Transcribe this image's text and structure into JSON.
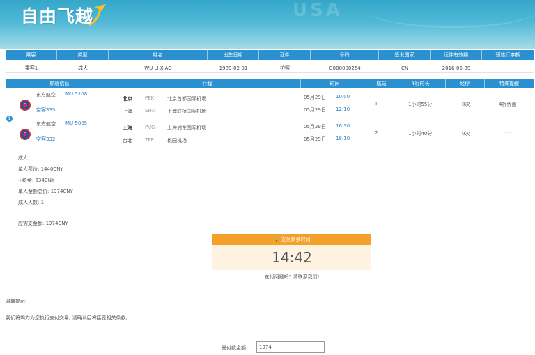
{
  "header": {
    "logo_text": "自由飞越",
    "background_text": "USA"
  },
  "passenger_table": {
    "headers": [
      "乘客",
      "类型",
      "姓名",
      "出生日期",
      "证件",
      "号码",
      "签发国家",
      "证件有效期",
      "预达行李额"
    ],
    "row": [
      "乘客1",
      "成人",
      "WU LI XIAO",
      "1989-02-01",
      "护照",
      "G000000254",
      "CN",
      "2016-05-09",
      "· · ·"
    ]
  },
  "flight_table": {
    "headers": [
      "航班信息",
      "行程",
      "时间",
      "航站",
      "飞行时长",
      "经停",
      "特殊提醒"
    ],
    "segments": [
      {
        "airline": "东方航空",
        "flight_no": "MU 5108",
        "aircraft": "空客333",
        "stops": [
          {
            "city": "北京",
            "code": "PEK",
            "airport": "北京首都国际机场",
            "date": "05月29日",
            "time": "10:00"
          },
          {
            "city": "上海",
            "code": "SHA",
            "airport": "上海虹桥国际机场",
            "date": "05月29日",
            "time": "12:10"
          }
        ],
        "terminal": "T",
        "duration": "1小时55分",
        "stop_count": "0次",
        "note": "4折优惠"
      },
      {
        "airline": "东方航空",
        "flight_no": "MU 5005",
        "aircraft": "空客332",
        "stops": [
          {
            "city": "上海",
            "code": "PVG",
            "airport": "上海浦东国际机场",
            "date": "05月29日",
            "time": "16:30"
          },
          {
            "city": "台北",
            "code": "TPE",
            "airport": "桃园机场",
            "date": "05月29日",
            "time": "18:10"
          }
        ],
        "terminal": "2",
        "duration": "1小时40分",
        "stop_count": "0次",
        "note": "· · ·"
      }
    ]
  },
  "price_summary": {
    "category": "成人",
    "unit_price": "单人票价: 1440CNY",
    "tax": "+税金: 534CNY",
    "total_per_person": "单人金额总价: 1974CNY",
    "count": "成人人数:   1",
    "order_total": "应需支金额: 1974CNY"
  },
  "timer": {
    "header": "支付剩余时间",
    "time": "14:42",
    "note": "支付问题吗?  请联系我们!"
  },
  "notice": {
    "title": "温馨提示:",
    "text": "我们将竭力为您执行支付交易, 请确认后将接受相关条款。"
  },
  "payment": {
    "label": "需付款金额:",
    "value": "1974"
  },
  "colors": {
    "table_header": "#2b90d0",
    "timer_header": "#f3a12a",
    "timer_body": "#fdf3e0"
  }
}
